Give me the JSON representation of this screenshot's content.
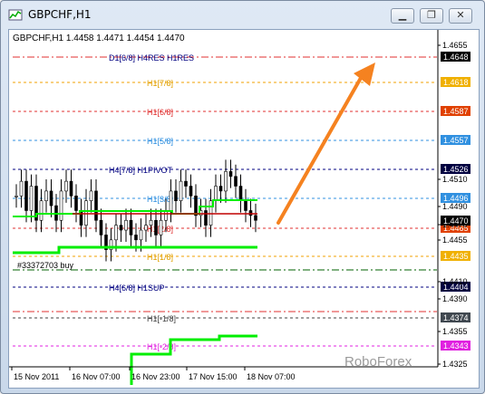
{
  "window": {
    "title": "GBPCHF,H1",
    "minimize_label": "▁",
    "restore_label": "❐",
    "close_label": "✕"
  },
  "chart": {
    "header": "GBPCHF,H1  1.4458  1.4471  1.4454  1.4470",
    "watermark": "RoboForex",
    "order_label": "#33372703 buy",
    "colors": {
      "bull_line": "#00ee00",
      "price_line": "#c00000",
      "arrow": "#f58220",
      "candles": "#000000"
    }
  },
  "levels": [
    {
      "label": "D1[6/8] H4RES H1RES",
      "price": "1.4648",
      "color": "#e03030",
      "label_color": "#000080",
      "badge_bg": "#000000",
      "badge_fg": "#ffffff",
      "style": "dashdot"
    },
    {
      "label": "H1[7/8]",
      "price": "1.4618",
      "color": "#f0a000",
      "label_color": "#e0a000",
      "badge_bg": "#f0b000",
      "badge_fg": "#ffffff",
      "style": "dash"
    },
    {
      "label": "H1[6/8]",
      "price": "1.4587",
      "color": "#e03030",
      "label_color": "#e03030",
      "badge_bg": "#e04000",
      "badge_fg": "#ffffff",
      "style": "dash"
    },
    {
      "label": "H1[5/8]",
      "price": "1.4557",
      "color": "#3090e0",
      "label_color": "#3090e0",
      "badge_bg": "#3090e0",
      "badge_fg": "#ffffff",
      "style": "dash"
    },
    {
      "label": "H4[7/8] H1PIVOT",
      "price": "1.4526",
      "color": "#000080",
      "label_color": "#000080",
      "badge_bg": "#000040",
      "badge_fg": "#ffffff",
      "style": "dash"
    },
    {
      "label": "H1[3/8]",
      "price": "1.4496",
      "color": "#3090e0",
      "label_color": "#3090e0",
      "badge_bg": "#3090e0",
      "badge_fg": "#ffffff",
      "style": "dash"
    },
    {
      "label": "H1[2/8]",
      "price": "1.4465",
      "color": "#e03030",
      "label_color": "#e03030",
      "badge_bg": "#e04000",
      "badge_fg": "#ffffff",
      "style": "dash"
    },
    {
      "label": "H1[1/8]",
      "price": "1.4435",
      "color": "#f0a000",
      "label_color": "#e0a000",
      "badge_bg": "#f0b000",
      "badge_fg": "#ffffff",
      "style": "dash"
    },
    {
      "label": "",
      "price": "",
      "color": "#006000",
      "label_color": "#006000",
      "badge_bg": "",
      "badge_fg": "",
      "style": "dashdot"
    },
    {
      "label": "H4[6/8] H1SUP",
      "price": "1.4404",
      "color": "#000080",
      "label_color": "#000080",
      "badge_bg": "#000040",
      "badge_fg": "#ffffff",
      "style": "dash"
    },
    {
      "label": "",
      "price": "",
      "color": "#e03030",
      "label_color": "#e03030",
      "badge_bg": "",
      "badge_fg": "",
      "style": "dashdot"
    },
    {
      "label": "H1[-1/8]",
      "price": "1.4374",
      "color": "#404040",
      "label_color": "#404040",
      "badge_bg": "#404850",
      "badge_fg": "#ffffff",
      "style": "dash"
    },
    {
      "label": "H1[-2/8]",
      "price": "1.4343",
      "color": "#e020e0",
      "label_color": "#e020e0",
      "badge_bg": "#e020e0",
      "badge_fg": "#ffffff",
      "style": "dash"
    }
  ],
  "price_axis": {
    "ticks": [
      "1.4655",
      "1.4510",
      "1.4490",
      "1.4470",
      "1.4455",
      "1.4410",
      "1.4390",
      "1.4355",
      "1.4325"
    ],
    "current_price": "1.4470",
    "current_bg": "#000000",
    "current_fg": "#ffffff"
  },
  "time_axis": {
    "ticks": [
      "15 Nov 2011",
      "16 Nov 07:00",
      "16 Nov 23:00",
      "17 Nov 15:00",
      "18 Nov 07:00"
    ]
  },
  "chart_data": {
    "type": "candlestick",
    "symbol": "GBPCHF",
    "timeframe": "H1",
    "ohlc_last": {
      "open": 1.4458,
      "high": 1.4471,
      "low": 1.4454,
      "close": 1.447
    },
    "ylim": [
      1.432,
      1.4665
    ],
    "x_categories": [
      "15 Nov 2011",
      "16 Nov 07:00",
      "16 Nov 23:00",
      "17 Nov 15:00",
      "18 Nov 07:00"
    ],
    "closes": [
      1.4495,
      1.451,
      1.448,
      1.4505,
      1.447,
      1.449,
      1.45,
      1.4485,
      1.447,
      1.45,
      1.451,
      1.4495,
      1.448,
      1.4465,
      1.449,
      1.45,
      1.447,
      1.4455,
      1.444,
      1.445,
      1.4465,
      1.446,
      1.447,
      1.4455,
      1.445,
      1.446,
      1.4465,
      1.447,
      1.4455,
      1.447,
      1.448,
      1.45,
      1.449,
      1.451,
      1.4505,
      1.4495,
      1.4475,
      1.448,
      1.4465,
      1.449,
      1.4505,
      1.45,
      1.452,
      1.4515,
      1.4505,
      1.449,
      1.448,
      1.4475,
      1.447
    ]
  }
}
